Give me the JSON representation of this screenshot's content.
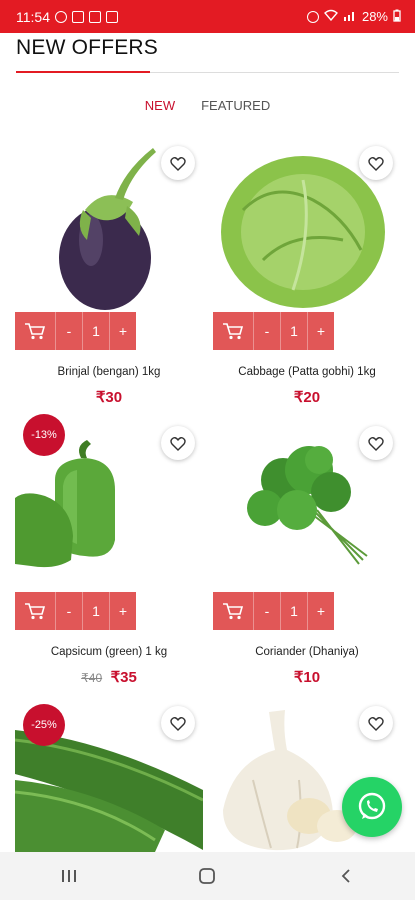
{
  "status_bar": {
    "time": "11:54",
    "battery": "28%"
  },
  "header": {
    "title": "NEW OFFERS"
  },
  "tabs": [
    {
      "label": "NEW"
    },
    {
      "label": "FEATURED"
    }
  ],
  "accent_color": "#e31b23",
  "products": [
    {
      "name": "Brinjal (bengan) 1kg",
      "price": "₹30",
      "old_price": "",
      "discount": "",
      "qty": "1",
      "minus": "-",
      "plus": "+"
    },
    {
      "name": "Cabbage (Patta gobhi) 1kg",
      "price": "₹20",
      "old_price": "",
      "discount": "",
      "qty": "1",
      "minus": "-",
      "plus": "+"
    },
    {
      "name": "Capsicum (green) 1 kg",
      "price": "₹35",
      "old_price": "₹40",
      "discount": "-13%",
      "qty": "1",
      "minus": "-",
      "plus": "+"
    },
    {
      "name": "Coriander (Dhaniya)",
      "price": "₹10",
      "old_price": "",
      "discount": "",
      "qty": "1",
      "minus": "-",
      "plus": "+"
    },
    {
      "name": "",
      "price": "",
      "old_price": "",
      "discount": "-25%",
      "qty": "",
      "minus": "",
      "plus": ""
    },
    {
      "name": "",
      "price": "",
      "old_price": "",
      "discount": "",
      "qty": "",
      "minus": "",
      "plus": ""
    }
  ]
}
